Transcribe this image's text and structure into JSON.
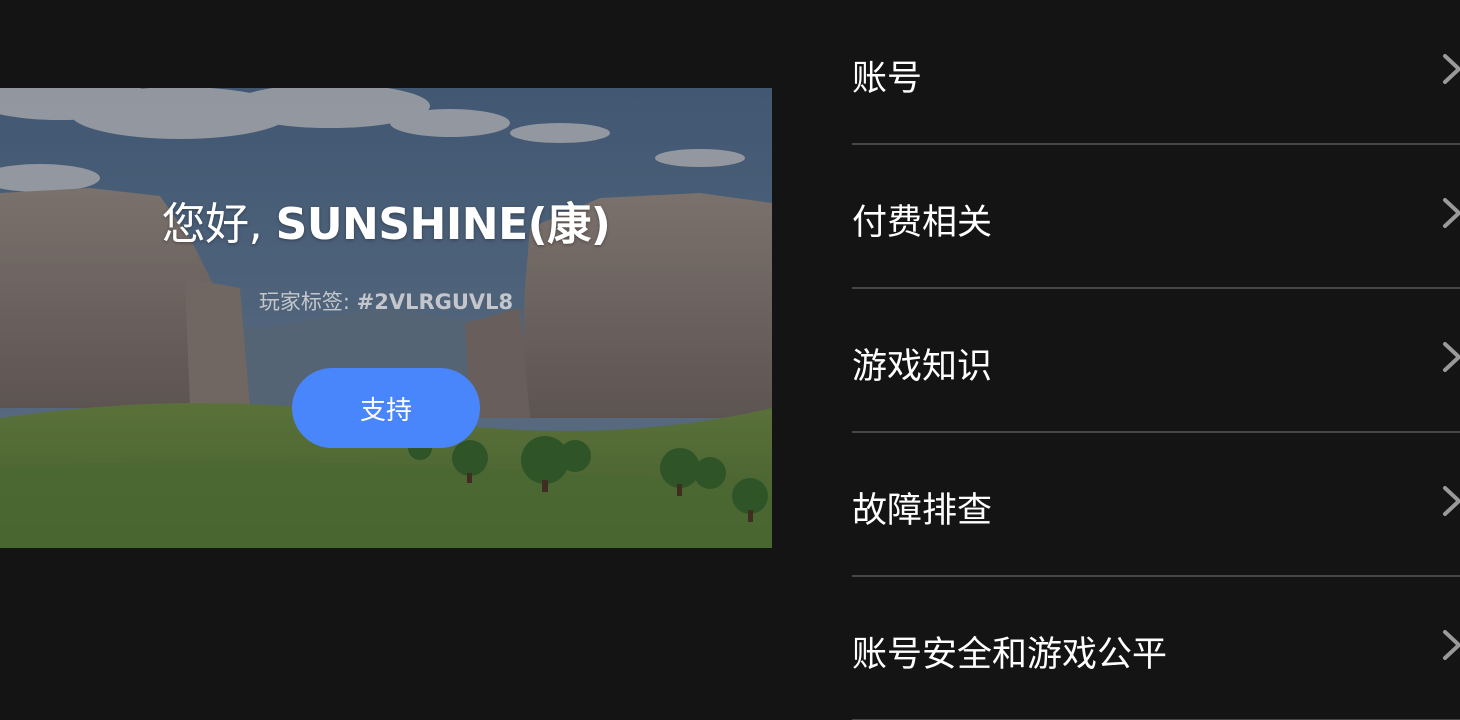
{
  "banner": {
    "greeting_prefix": "您好, ",
    "player_name": "SUNSHINE(康)",
    "tag_label": "玩家标签: ",
    "tag_value": "#2VLRGUVL8",
    "support_label": "支持"
  },
  "menu": {
    "items": [
      {
        "label": "账号",
        "icon": "chevron-right-icon"
      },
      {
        "label": "付费相关",
        "icon": "chevron-right-icon"
      },
      {
        "label": "游戏知识",
        "icon": "chevron-right-icon"
      },
      {
        "label": "故障排查",
        "icon": "chevron-right-icon"
      },
      {
        "label": "账号安全和游戏公平",
        "icon": "chevron-right-icon"
      }
    ]
  },
  "colors": {
    "background": "#141414",
    "accent": "#4a86fb",
    "divider": "#474747",
    "text": "#ffffff",
    "subtext": "#c4c6cb"
  }
}
